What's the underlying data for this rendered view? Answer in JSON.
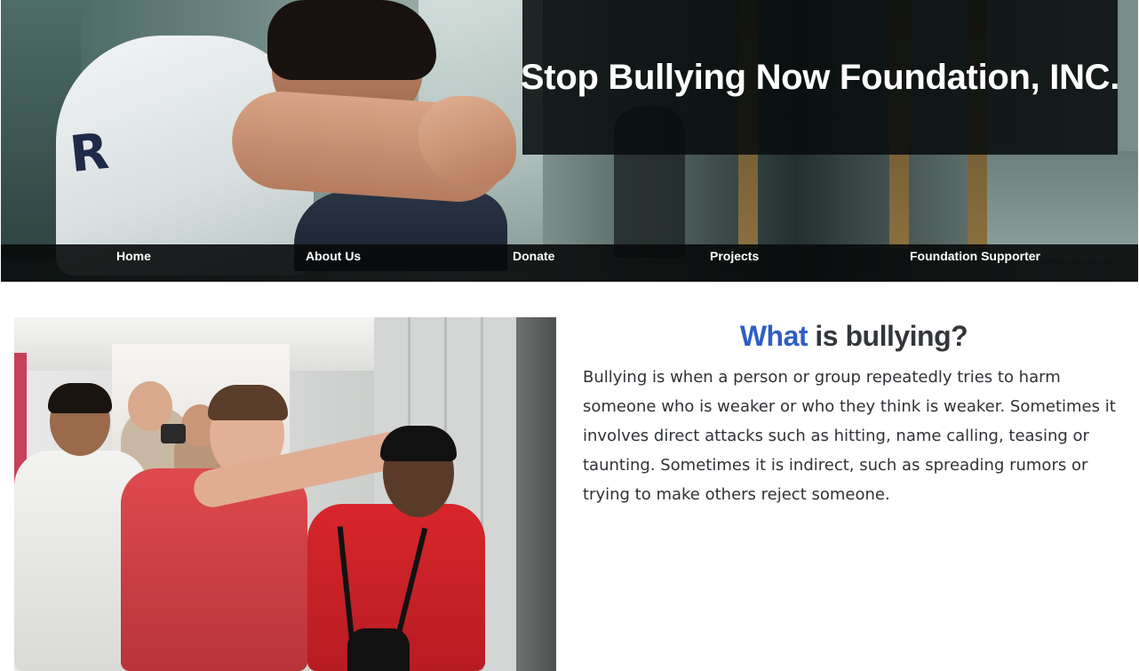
{
  "hero": {
    "title": "Stop Bullying Now Foundation, INC.",
    "image_alt": "teen boy sitting with head resting on folded arms in a school hallway"
  },
  "nav": {
    "items": [
      {
        "label": "Home"
      },
      {
        "label": "About Us"
      },
      {
        "label": "Donate"
      },
      {
        "label": "Projects"
      },
      {
        "label": "Foundation Supporter"
      }
    ]
  },
  "main": {
    "photo_alt": "students filming while a student is pushed against a locker",
    "heading_accent": "What",
    "heading_rest": "is bullying?",
    "paragraph": "Bullying is when a person or group repeatedly tries to harm someone who is weaker or who they think is weaker. Sometimes it involves direct attacks such as hitting, name calling, teasing or taunting. Sometimes it is indirect, such as spreading rumors or trying to make others reject someone."
  },
  "colors": {
    "accent": "#2f5ec4",
    "heading_text": "#33363a",
    "body_text": "#2f3236",
    "overlay": "#080c0c"
  }
}
